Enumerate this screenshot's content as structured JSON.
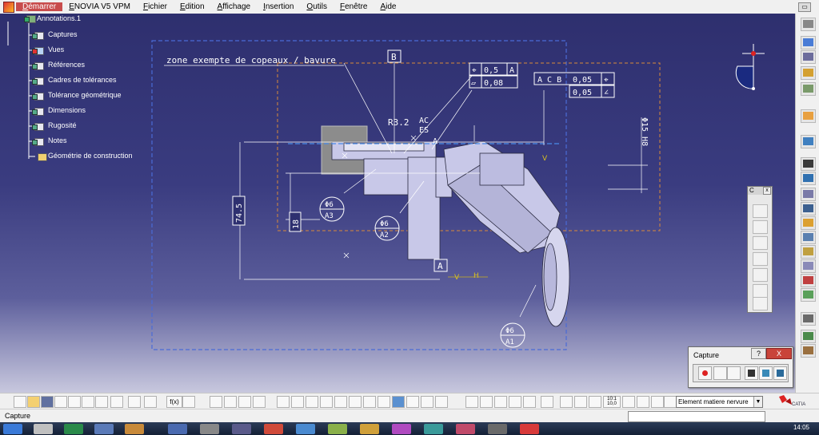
{
  "menu": {
    "items": [
      "Démarrer",
      "ENOVIA V5 VPM",
      "Fichier",
      "Edition",
      "Affichage",
      "Insertion",
      "Outils",
      "Fenêtre",
      "Aide"
    ]
  },
  "tree": {
    "root": "Annotations.1",
    "items": [
      {
        "label": "Captures",
        "icon": "capture-icon"
      },
      {
        "label": "Vues",
        "icon": "views-icon"
      },
      {
        "label": "Références",
        "icon": "references-icon"
      },
      {
        "label": "Cadres de tolérances",
        "icon": "tolerance-frame-icon"
      },
      {
        "label": "Tolérance géométrique",
        "icon": "geometric-tolerance-icon"
      },
      {
        "label": "Dimensions",
        "icon": "dimension-icon"
      },
      {
        "label": "Rugosité",
        "icon": "roughness-icon"
      },
      {
        "label": "Notes",
        "icon": "note-icon"
      },
      {
        "label": "Géométrie de construction",
        "icon": "construction-geometry-icon"
      }
    ]
  },
  "annotations": {
    "note_zone": "zone exempte de copeaux / bavure",
    "datum_b": "B",
    "datum_a": "A",
    "radius": "R3.2",
    "ac": "AC",
    "es": "ES",
    "cut_a": "A",
    "tol1_value": "0,5",
    "tol1_ref": "A",
    "tol2_value": "0,08",
    "tol3_value": "0,05",
    "tol3_refs": "A C B",
    "tol4_value": "0,05",
    "dim_745": "74.5",
    "dim_18": "18",
    "dim_diam15": "Φ15 H8",
    "bubble1_top": "Φ6",
    "bubble1_bottom": "A3",
    "bubble2_top": "Φ6",
    "bubble2_bottom": "A2",
    "bubble3_top": "Φ6",
    "bubble3_bottom": "A1",
    "v_label": "V",
    "h_label": "H",
    "v2_label": "V"
  },
  "capture_dialog": {
    "title": "Capture",
    "help": "?",
    "close": "X"
  },
  "bottom_toolbar": {
    "element_select_value": "Element matiere nervure",
    "fx_label": "f(x)",
    "scale_label": "10:1 10,0"
  },
  "status": {
    "text": "Capture"
  },
  "taskbar": {
    "clock": "14:05"
  },
  "colors": {
    "viewport_top": "#2e2f6e",
    "selection_box": "#4a6bd6",
    "limit_box": "#d98a3a",
    "annotation": "#ffffff",
    "part": "#c8c8e8"
  },
  "brand": {
    "logo_text": "CATIA"
  }
}
